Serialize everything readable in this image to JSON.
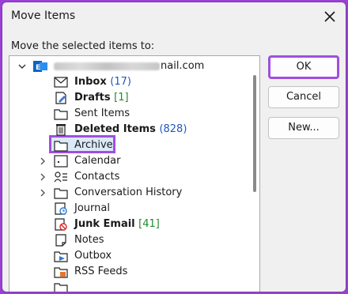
{
  "dialog": {
    "title": "Move Items",
    "prompt": "Move the selected items to:"
  },
  "buttons": {
    "ok": "OK",
    "cancel": "Cancel",
    "new": "New..."
  },
  "account": {
    "email_suffix": "nail.com"
  },
  "folders": [
    {
      "label": "Inbox",
      "count": "(17)"
    },
    {
      "label": "Drafts",
      "count": "[1]"
    },
    {
      "label": "Sent Items"
    },
    {
      "label": "Deleted Items",
      "count": "(828)"
    },
    {
      "label": "Archive"
    },
    {
      "label": "Calendar"
    },
    {
      "label": "Contacts"
    },
    {
      "label": "Conversation History"
    },
    {
      "label": "Journal"
    },
    {
      "label": "Junk Email",
      "count": "[41]"
    },
    {
      "label": "Notes"
    },
    {
      "label": "Outbox"
    },
    {
      "label": "RSS Feeds"
    }
  ],
  "icons": {
    "account": "outlook-account-icon",
    "close": "close-icon"
  },
  "colors": {
    "highlight": "#a14ee0",
    "count_blue": "#1f57c4",
    "count_green": "#1f8a2e"
  }
}
